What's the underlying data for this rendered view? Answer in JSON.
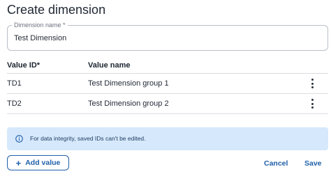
{
  "dialog": {
    "title": "Create dimension"
  },
  "dimension_name_field": {
    "label": "Dimension name *",
    "value": "Test Dimension"
  },
  "values_table": {
    "headers": {
      "value_id": "Value ID*",
      "value_name": "Value name"
    },
    "rows": [
      {
        "id": "TD1",
        "name": "Test Dimension group 1",
        "menu_icon": "more-vertical-icon"
      },
      {
        "id": "TD2",
        "name": "Test Dimension group 2",
        "menu_icon": "more-vertical-icon"
      }
    ]
  },
  "info_banner": {
    "icon": "info-icon",
    "text": "For data integrity, saved IDs can't be edited."
  },
  "actions": {
    "add_value_label": "Add value",
    "add_icon": "plus-icon",
    "cancel_label": "Cancel",
    "save_label": "Save"
  },
  "colors": {
    "accent": "#1f5fa8",
    "info_background": "#d6e8fb",
    "border": "#b9bec6",
    "divider": "#d9dce1"
  }
}
